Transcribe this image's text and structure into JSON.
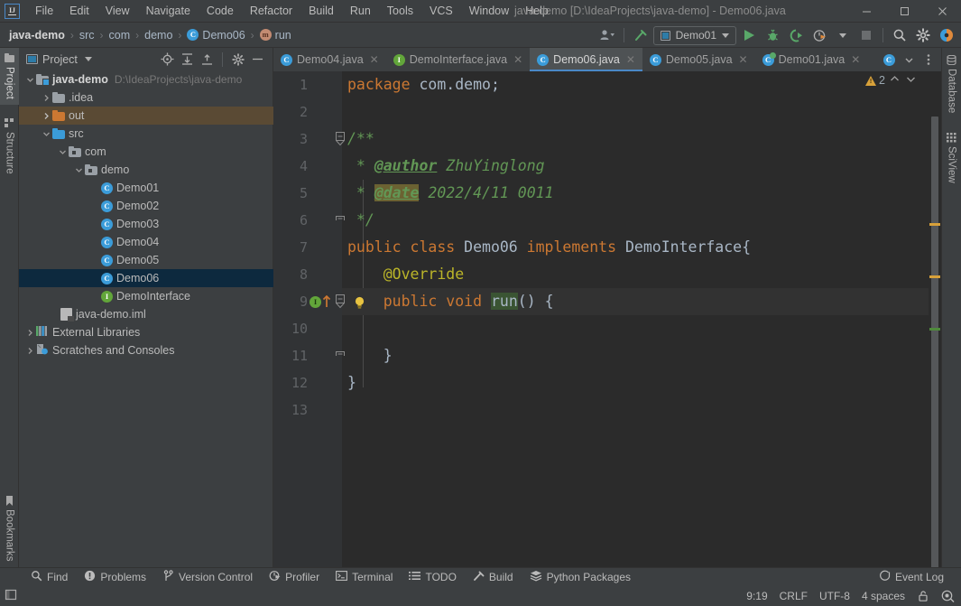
{
  "window": {
    "title": "java-demo [D:\\IdeaProjects\\java-demo] - Demo06.java",
    "minimize_label": "—",
    "maximize_label": "☐",
    "close_label": "✕",
    "logo_text": "IJ"
  },
  "menu": {
    "items": [
      {
        "label": "File"
      },
      {
        "label": "Edit"
      },
      {
        "label": "View"
      },
      {
        "label": "Navigate"
      },
      {
        "label": "Code"
      },
      {
        "label": "Refactor"
      },
      {
        "label": "Build"
      },
      {
        "label": "Run"
      },
      {
        "label": "Tools"
      },
      {
        "label": "VCS"
      },
      {
        "label": "Window"
      },
      {
        "label": "Help"
      }
    ]
  },
  "breadcrumb": {
    "items": [
      {
        "label": "java-demo",
        "icon": "none",
        "bold": true
      },
      {
        "label": "src",
        "icon": "none",
        "bold": false
      },
      {
        "label": "com",
        "icon": "none",
        "bold": false
      },
      {
        "label": "demo",
        "icon": "none",
        "bold": false
      },
      {
        "label": "Demo06",
        "icon": "class-icon",
        "bold": false
      },
      {
        "label": "run",
        "icon": "method-icon",
        "bold": false
      }
    ],
    "separator": "›"
  },
  "toolbar": {
    "run_config": "Demo01",
    "icons": [
      "user-avatar-icon",
      "build-hammer-icon",
      "run-icon",
      "debug-icon",
      "run-coverage-icon",
      "profiler-icon",
      "stop-icon",
      "search-everywhere-icon",
      "settings-gear-icon",
      "ide-assistant-icon"
    ]
  },
  "left_rail": {
    "items": [
      {
        "label": "Project",
        "icon": "project-icon",
        "active": true
      },
      {
        "label": "Structure",
        "icon": "structure-icon",
        "active": false
      },
      {
        "label": "Bookmarks",
        "icon": "bookmark-icon",
        "active": false
      }
    ]
  },
  "right_rail": {
    "items": [
      {
        "label": "Database",
        "icon": "database-icon"
      },
      {
        "label": "SciView",
        "icon": "sciview-icon"
      }
    ]
  },
  "project_panel": {
    "title": "Project",
    "tool_icons": [
      "locate-icon",
      "expand-all-icon",
      "collapse-all-icon",
      "settings-gear-icon",
      "hide-icon"
    ],
    "tree": [
      {
        "label": "java-demo",
        "path": "D:\\IdeaProjects\\java-demo",
        "indent": 0,
        "arrow": "down",
        "icon": "module-folder-icon",
        "state": "normal",
        "bold": true
      },
      {
        "label": ".idea",
        "path": "",
        "indent": 1,
        "arrow": "right",
        "icon": "folder-gray-icon",
        "state": "normal",
        "bold": false
      },
      {
        "label": "out",
        "path": "",
        "indent": 1,
        "arrow": "right",
        "icon": "folder-orange-icon",
        "state": "hover",
        "bold": false
      },
      {
        "label": "src",
        "path": "",
        "indent": 1,
        "arrow": "down",
        "icon": "folder-blue-icon",
        "state": "normal",
        "bold": false
      },
      {
        "label": "com",
        "path": "",
        "indent": 2,
        "arrow": "down",
        "icon": "package-icon",
        "state": "normal",
        "bold": false
      },
      {
        "label": "demo",
        "path": "",
        "indent": 3,
        "arrow": "down",
        "icon": "package-icon",
        "state": "normal",
        "bold": false
      },
      {
        "label": "Demo01",
        "path": "",
        "indent": 4,
        "arrow": "none",
        "icon": "class-icon",
        "state": "normal",
        "bold": false
      },
      {
        "label": "Demo02",
        "path": "",
        "indent": 4,
        "arrow": "none",
        "icon": "class-icon",
        "state": "normal",
        "bold": false
      },
      {
        "label": "Demo03",
        "path": "",
        "indent": 4,
        "arrow": "none",
        "icon": "class-icon",
        "state": "normal",
        "bold": false
      },
      {
        "label": "Demo04",
        "path": "",
        "indent": 4,
        "arrow": "none",
        "icon": "class-icon",
        "state": "normal",
        "bold": false
      },
      {
        "label": "Demo05",
        "path": "",
        "indent": 4,
        "arrow": "none",
        "icon": "class-icon",
        "state": "normal",
        "bold": false
      },
      {
        "label": "Demo06",
        "path": "",
        "indent": 4,
        "arrow": "none",
        "icon": "class-icon",
        "state": "selected",
        "bold": false
      },
      {
        "label": "DemoInterface",
        "path": "",
        "indent": 4,
        "arrow": "none",
        "icon": "interface-icon",
        "state": "normal",
        "bold": false
      },
      {
        "label": "java-demo.iml",
        "path": "",
        "indent": 2,
        "arrow": "none",
        "icon": "iml-file-icon",
        "state": "normal",
        "bold": false
      },
      {
        "label": "External Libraries",
        "path": "",
        "indent": 0,
        "arrow": "right",
        "icon": "library-icon",
        "state": "normal",
        "bold": false
      },
      {
        "label": "Scratches and Consoles",
        "path": "",
        "indent": 0,
        "arrow": "right",
        "icon": "scratches-icon",
        "state": "normal",
        "bold": false
      }
    ]
  },
  "editor": {
    "tabs": [
      {
        "label": "Demo04.java",
        "icon": "class-icon",
        "active": false
      },
      {
        "label": "DemoInterface.java",
        "icon": "interface-icon",
        "active": false
      },
      {
        "label": "Demo06.java",
        "icon": "class-icon",
        "active": true
      },
      {
        "label": "Demo05.java",
        "icon": "class-icon",
        "active": false
      },
      {
        "label": "Demo01.java",
        "icon": "class-runnable-icon",
        "active": false
      }
    ],
    "tab_close_label": "✕",
    "tabs_overflow_icon": "chevron-down-icon",
    "tabs_more_icon": "kebab-menu-icon",
    "inspection": {
      "warning_count": "2",
      "up_label": "⌃",
      "down_label": "⌄"
    },
    "line_numbers": [
      "1",
      "2",
      "3",
      "4",
      "5",
      "6",
      "7",
      "8",
      "9",
      "10",
      "11",
      "12",
      "13"
    ],
    "code_lines": [
      {
        "n": "1",
        "segments": [
          {
            "t": "package",
            "c": "kw"
          },
          {
            "t": " ",
            "c": "plain"
          },
          {
            "t": "com.demo;",
            "c": "plain"
          }
        ]
      },
      {
        "n": "2",
        "segments": []
      },
      {
        "n": "3",
        "segments": [
          {
            "t": "/**",
            "c": "cmt"
          }
        ]
      },
      {
        "n": "4",
        "segments": [
          {
            "t": " * ",
            "c": "cmt"
          },
          {
            "t": "@author",
            "c": "doctag"
          },
          {
            "t": " ZhuYinglong",
            "c": "cmt"
          }
        ]
      },
      {
        "n": "5",
        "segments": [
          {
            "t": " * ",
            "c": "cmt"
          },
          {
            "t": "@date",
            "c": "doctag warn"
          },
          {
            "t": " 2022/4/11 0011",
            "c": "cmt"
          }
        ]
      },
      {
        "n": "6",
        "segments": [
          {
            "t": " */",
            "c": "cmt"
          }
        ]
      },
      {
        "n": "7",
        "segments": [
          {
            "t": "public class ",
            "c": "kw"
          },
          {
            "t": "Demo06",
            "c": "cls"
          },
          {
            "t": " implements ",
            "c": "kw"
          },
          {
            "t": "DemoInterface{",
            "c": "cls"
          }
        ]
      },
      {
        "n": "8",
        "segments": [
          {
            "t": "    ",
            "c": "plain"
          },
          {
            "t": "@Override",
            "c": "anno"
          }
        ]
      },
      {
        "n": "9",
        "segments": [
          {
            "t": "    ",
            "c": "plain"
          },
          {
            "t": "public void ",
            "c": "kw"
          },
          {
            "t": "run",
            "c": "mth"
          },
          {
            "t": "() {",
            "c": "plain"
          }
        ]
      },
      {
        "n": "10",
        "segments": []
      },
      {
        "n": "11",
        "segments": [
          {
            "t": "    }",
            "c": "plain"
          }
        ]
      },
      {
        "n": "12",
        "segments": [
          {
            "t": "}",
            "c": "plain"
          }
        ]
      },
      {
        "n": "13",
        "segments": []
      }
    ]
  },
  "bottom_bar": {
    "items": [
      {
        "label": "Find",
        "icon": "search-icon"
      },
      {
        "label": "Problems",
        "icon": "problems-icon"
      },
      {
        "label": "Version Control",
        "icon": "branch-icon"
      },
      {
        "label": "Profiler",
        "icon": "profiler-icon"
      },
      {
        "label": "Terminal",
        "icon": "terminal-icon"
      },
      {
        "label": "TODO",
        "icon": "todo-list-icon"
      },
      {
        "label": "Build",
        "icon": "hammer-icon"
      },
      {
        "label": "Python Packages",
        "icon": "packages-icon"
      }
    ],
    "event_log": {
      "label": "Event Log",
      "icon": "event-log-icon"
    }
  },
  "status_bar": {
    "position": "9:19",
    "line_separator": "CRLF",
    "encoding": "UTF-8",
    "indent": "4 spaces",
    "lock_icon": "lock-icon",
    "inspection_icon": "inspection-widget-icon",
    "left_icon": "show-tool-windows-icon"
  },
  "colors": {
    "accent_blue": "#4a88c7",
    "keyword_orange": "#cc7832",
    "comment_green": "#629755",
    "annotation_yellow": "#bbb529",
    "class_icon_blue": "#3b9cd9",
    "interface_icon_green": "#62a63a",
    "selection_navy": "#0d293e",
    "warning_yellow": "#d8a13a",
    "editor_bg": "#2b2b2b",
    "panel_bg": "#3c3f41"
  }
}
